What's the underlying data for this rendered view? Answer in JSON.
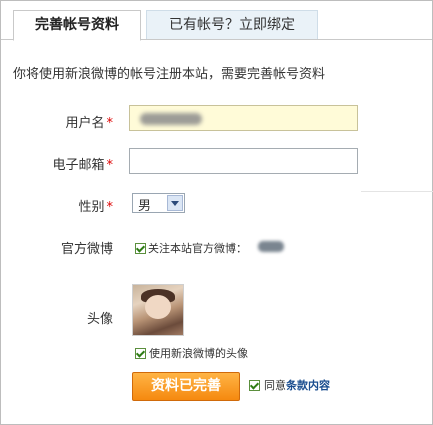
{
  "tabs": [
    {
      "label": "完善帐号资料",
      "active": true
    },
    {
      "label": "已有帐号？立即绑定",
      "active": false
    }
  ],
  "intro": "你将使用新浪微博的帐号注册本站，需要完善帐号资料",
  "form": {
    "username_label": "用户名",
    "email_label": "电子邮箱",
    "gender_label": "性别",
    "gender_value": "男",
    "weibo_label": "官方微博",
    "follow_text": "关注本站官方微博：",
    "avatar_label": "头像",
    "use_avatar_text": "使用新浪微博的头像",
    "submit_label": "资料已完善",
    "agree_text": "同意",
    "terms_text": "条款内容",
    "required_mark": "*"
  },
  "colors": {
    "accent": "#f5890f",
    "required": "#dd0000",
    "link": "#1a4d8f",
    "filled_input_bg": "#fffbd8"
  },
  "icons": [
    "checkbox-checked-icon",
    "dropdown-arrow-icon"
  ]
}
